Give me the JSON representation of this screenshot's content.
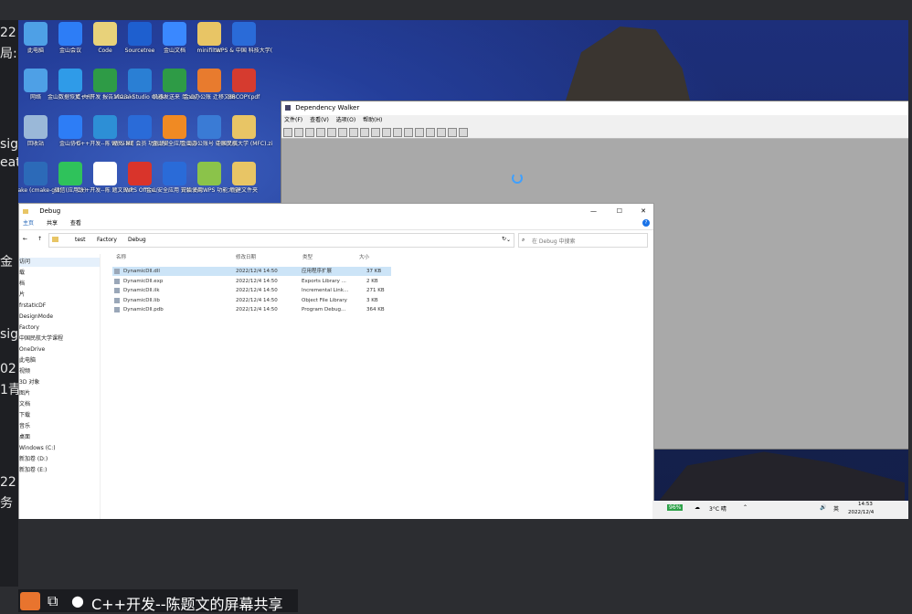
{
  "left_panel": {
    "fragments": [
      "22",
      "局:",
      "sig",
      "eat",
      "金",
      "sig",
      "02",
      "1青",
      "22",
      "务"
    ]
  },
  "desktop": {
    "icons": [
      {
        "label": "此电脑",
        "color": "#4ea0e6"
      },
      {
        "label": "金山会议",
        "color": "#2d7df6"
      },
      {
        "label": "Code",
        "color": "#e8d27a"
      },
      {
        "label": "Sourcetree",
        "color": "#1e5fcf"
      },
      {
        "label": "金山文档",
        "color": "#3a88ff"
      },
      {
        "label": "minifilter",
        "color": "#e8c565"
      },
      {
        "label": "WPS & 中国\n科技大学(合...",
        "color": "#2a6bd8"
      },
      {
        "label": "网络",
        "color": "#4ea0e6"
      },
      {
        "label": "金山数据恢复\n大师",
        "color": "#2f9be8"
      },
      {
        "label": "C++开发\n报告2023.xlsx",
        "color": "#2e9b46"
      },
      {
        "label": "Visual\nStudio Code",
        "color": "#2a7fd4"
      },
      {
        "label": "机器发送来\n单.xls",
        "color": "#2e9b46"
      },
      {
        "label": "金山办公账\n迁移文档",
        "color": "#e87b2e"
      },
      {
        "label": "BBCOPY.pdf",
        "color": "#d63b2f"
      },
      {
        "label": "回收站",
        "color": "#9ab8d8"
      },
      {
        "label": "金山协作",
        "color": "#2d7df6"
      },
      {
        "label": "C++开发--陈\n题文(课程..",
        "color": "#2d8fd6"
      },
      {
        "label": "WPS-ME 会员\n功能使用...",
        "color": "#2a6bd8"
      },
      {
        "label": "金山安全应用\n商店",
        "color": "#f08a23"
      },
      {
        "label": "金山办公账号\n迁移文档.zip",
        "color": "#3a7bd5"
      },
      {
        "label": "中国民航大学\n(MFC).zip",
        "color": "#e8c565"
      },
      {
        "label": "CMake\n(cmake-gui)",
        "color": "#2c6ab8"
      },
      {
        "label": "微信(应用版)",
        "color": "#2fc25b"
      },
      {
        "label": "C++开发--陈\n题文的大学..",
        "color": "#ffffff"
      },
      {
        "label": "WPS Office",
        "color": "#d9342b"
      },
      {
        "label": "金山安全应用\n安装.docx",
        "color": "#2a6bd8"
      },
      {
        "label": "开始使用WPS\n功能大全",
        "color": "#8bc34a"
      },
      {
        "label": "新建文件夹",
        "color": "#e8c565"
      }
    ]
  },
  "dependency_walker": {
    "title": "Dependency Walker",
    "menu": [
      "文件(F)",
      "查看(V)",
      "选项(O)",
      "帮助(H)"
    ]
  },
  "explorer": {
    "title": "Debug",
    "ribbon": [
      "主页",
      "共享",
      "查看"
    ],
    "breadcrumb": [
      "test",
      "Factory",
      "Debug"
    ],
    "search_placeholder": "在 Debug 中搜索",
    "columns": [
      "名称",
      "修改日期",
      "类型",
      "大小"
    ],
    "nav_items": [
      "访问",
      "载",
      "档",
      "片",
      "frstatIcDF",
      "DesignMode",
      "Factory",
      "中国民航大学课程",
      "OneDrive",
      "此电脑",
      "视频",
      "3D 对象",
      "图片",
      "文档",
      "下载",
      "音乐",
      "桌面",
      "Windows (C:)",
      "新加卷 (D:)",
      "新加卷 (E:)"
    ],
    "files": [
      {
        "name": "DynamicDll.dll",
        "date": "2022/12/4 14:50",
        "type": "应用程序扩展",
        "size": "37 KB",
        "selected": true
      },
      {
        "name": "DynamicDll.exp",
        "date": "2022/12/4 14:50",
        "type": "Exports Library ...",
        "size": "2 KB",
        "selected": false
      },
      {
        "name": "DynamicDll.ilk",
        "date": "2022/12/4 14:50",
        "type": "Incremental Link...",
        "size": "271 KB",
        "selected": false
      },
      {
        "name": "DynamicDll.lib",
        "date": "2022/12/4 14:50",
        "type": "Object File Library",
        "size": "3 KB",
        "selected": false
      },
      {
        "name": "DynamicDll.pdb",
        "date": "2022/12/4 14:50",
        "type": "Program Debug...",
        "size": "364 KB",
        "selected": false
      }
    ]
  },
  "taskbar": {
    "battery": "96%",
    "weather": "3°C 晴",
    "ime": "英",
    "time": "14:53",
    "date": "2022/12/4"
  },
  "share_bar": {
    "text": "C++开发--陈题文的屏幕共享"
  }
}
